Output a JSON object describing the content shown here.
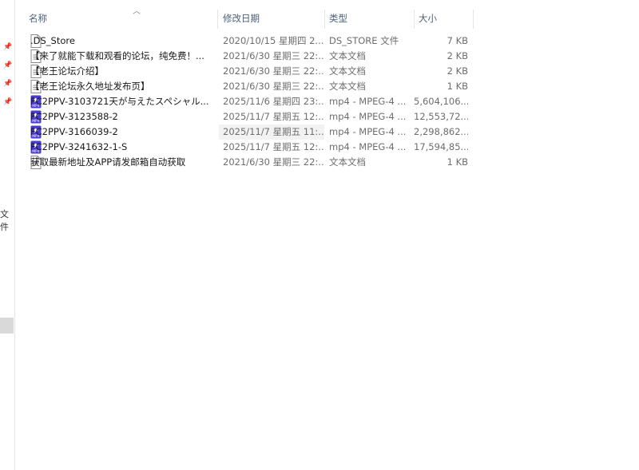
{
  "header": {
    "name_label": "名称",
    "date_label": "修改日期",
    "type_label": "类型",
    "size_label": "大小"
  },
  "nav": {
    "partial_label": "文件"
  },
  "files": [
    {
      "icon": "blank-file-icon",
      "name": ".DS_Store",
      "date": "2020/10/15 星期四 2...",
      "type": "DS_STORE 文件",
      "size": "7 KB"
    },
    {
      "icon": "text-file-icon",
      "name": "【来了就能下载和观看的论坛，纯免费！...",
      "date": "2021/6/30 星期三 22:...",
      "type": "文本文档",
      "size": "2 KB"
    },
    {
      "icon": "text-file-icon",
      "name": "【老王论坛介绍】",
      "date": "2021/6/30 星期三 22:...",
      "type": "文本文档",
      "size": "2 KB"
    },
    {
      "icon": "text-file-icon",
      "name": "【老王论坛永久地址发布页】",
      "date": "2021/6/30 星期三 22:...",
      "type": "文本文档",
      "size": "1 KB"
    },
    {
      "icon": "mp4-file-icon",
      "name": "FC2PPV-3103721天が与えたスペシャル...",
      "date": "2025/11/6 星期四 23:...",
      "type": "mp4 - MPEG-4 ...",
      "size": "5,604,106..."
    },
    {
      "icon": "mp4-file-icon",
      "name": "FC2PPV-3123588-2",
      "date": "2025/11/7 星期五 12:...",
      "type": "mp4 - MPEG-4 ...",
      "size": "12,553,72..."
    },
    {
      "icon": "mp4-file-icon",
      "name": "FC2PPV-3166039-2",
      "date": "2025/11/7 星期五 11:...",
      "type": "mp4 - MPEG-4 ...",
      "size": "2,298,862..."
    },
    {
      "icon": "mp4-file-icon",
      "name": "FC2PPV-3241632-1-S",
      "date": "2025/11/7 星期五 12:...",
      "type": "mp4 - MPEG-4 ...",
      "size": "17,594,85..."
    },
    {
      "icon": "text-file-icon",
      "name": "获取最新地址及APP请发邮箱自动获取",
      "date": "2021/6/30 星期三 22:...",
      "type": "文本文档",
      "size": "1 KB"
    }
  ],
  "colors": {
    "header_text": "#4c607a",
    "mp4_icon": "#4b3bd6",
    "hover_bg": "#f2f2f2"
  }
}
